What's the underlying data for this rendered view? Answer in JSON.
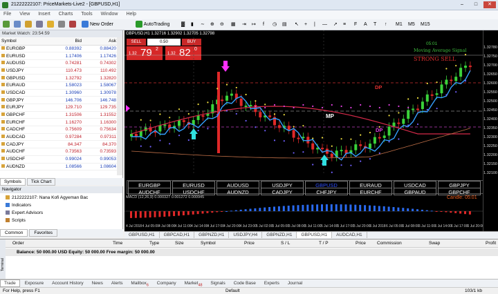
{
  "window": {
    "title": "21222222107: PriceMarkets-Live2 - [GBPUSD,H1]"
  },
  "menu": [
    "File",
    "View",
    "Insert",
    "Charts",
    "Tools",
    "Window",
    "Help"
  ],
  "toolbar": {
    "new_order": "New Order",
    "auto_trading": "AutoTrading"
  },
  "market_watch": {
    "header": "Market Watch: 23:54:59",
    "columns": [
      "Symbol",
      "Bid",
      "Ask"
    ],
    "rows": [
      {
        "symbol": "EURGBP",
        "bid": "0.88392",
        "ask": "0.88420",
        "dir": "up"
      },
      {
        "symbol": "EURUSD",
        "bid": "1.17406",
        "ask": "1.17426",
        "dir": "up"
      },
      {
        "symbol": "AUDUSD",
        "bid": "0.74281",
        "ask": "0.74302",
        "dir": "dn"
      },
      {
        "symbol": "USDJPY",
        "bid": "110.473",
        "ask": "110.492",
        "dir": "dn"
      },
      {
        "symbol": "GBPUSD",
        "bid": "1.32792",
        "ask": "1.32820",
        "dir": "dn"
      },
      {
        "symbol": "EURAUD",
        "bid": "1.58023",
        "ask": "1.58067",
        "dir": "up"
      },
      {
        "symbol": "USDCAD",
        "bid": "1.30960",
        "ask": "1.30978",
        "dir": "up"
      },
      {
        "symbol": "GBPJPY",
        "bid": "146.706",
        "ask": "146.748",
        "dir": "up"
      },
      {
        "symbol": "EURJPY",
        "bid": "129.710",
        "ask": "129.735",
        "dir": "dn"
      },
      {
        "symbol": "GBPCHF",
        "bid": "1.31506",
        "ask": "1.31552",
        "dir": "dn"
      },
      {
        "symbol": "EURCHF",
        "bid": "1.16270",
        "ask": "1.16300",
        "dir": "dn"
      },
      {
        "symbol": "CADCHF",
        "bid": "0.75609",
        "ask": "0.75634",
        "dir": "dn"
      },
      {
        "symbol": "AUDCAD",
        "bid": "0.97284",
        "ask": "0.97311",
        "dir": "dn"
      },
      {
        "symbol": "CADJPY",
        "bid": "84.347",
        "ask": "84.370",
        "dir": "dn"
      },
      {
        "symbol": "AUDCHF",
        "bid": "0.73563",
        "ask": "0.73593",
        "dir": "dn"
      },
      {
        "symbol": "USDCHF",
        "bid": "0.99024",
        "ask": "0.99053",
        "dir": "up"
      },
      {
        "symbol": "AUDNZD",
        "bid": "1.08566",
        "ask": "1.08604",
        "dir": "up"
      }
    ],
    "tabs": [
      "Symbols",
      "Tick Chart"
    ]
  },
  "navigator": {
    "header": "Navigator",
    "items": [
      "2122222107: Nana Kofi Agyeman Bac",
      "Indicators",
      "Expert Advisors",
      "Scripts"
    ],
    "tabs": [
      "Common",
      "Favorites"
    ]
  },
  "chart": {
    "title": "GBPUSD,H1  1.32716 1.32902 1.32705 1.32798",
    "sell_label": "SELL",
    "buy_label": "BUY",
    "lot": "0.50",
    "sell_small": "1.32",
    "sell_big": "79",
    "sell_sup": "2",
    "buy_small": "1.32",
    "buy_big": "82",
    "buy_sup": "0",
    "ma_signal": "Moving Average Signal",
    "strong_sell": "STRONG SELL",
    "dp_label": "DP",
    "mp_label": "MP",
    "candle_label": "Candle:  05:01",
    "clock": "05:01",
    "macd_label": "MACD (12,26,9) 0.000327 0.001272 0.000945",
    "pairs_row1": [
      "EURGBP",
      "EURUSD",
      "AUDUSD",
      "USDJPY",
      "GBPUSD",
      "EURAUD",
      "USDCAD",
      "GBPJPY"
    ],
    "pairs_row2": [
      "AUDCHF",
      "USDCHF",
      "AUDNZD",
      "CADJPY",
      "CHFJPY",
      "EURCHF",
      "GBPAUD",
      "GBPCHF"
    ],
    "price_labels": [
      "1.32780",
      "1.32750",
      "1.32700",
      "1.32650",
      "1.32600",
      "1.32550",
      "1.32500",
      "1.32450",
      "1.32400",
      "1.32350",
      "1.32300",
      "1.32250",
      "1.32200",
      "1.32150",
      "1.32100"
    ],
    "time_labels": [
      "4 Jul 2018",
      "4 Jul 05:00",
      "4 Jul 08:00",
      "4 Jul 11:00",
      "4 Jul 14:00",
      "4 Jul 17:00",
      "4 Jul 20:00",
      "4 Jul 23:00",
      "5 Jul 02:00",
      "5 Jul 05:00",
      "5 Jul 08:00",
      "5 Jul 11:00",
      "5 Jul 14:00",
      "5 Jul 17:00",
      "5 Jul 20:00",
      "6 Jul 2018",
      "6 Jul 05:00",
      "6 Jul 08:00",
      "6 Jul 11:00",
      "6 Jul 14:00",
      "6 Jul 17:00",
      "6 Jul 20:00"
    ]
  },
  "chart_tabs": [
    "GBPUSD,H1",
    "GBPCAD,H1",
    "GBPNZD,H1",
    "USDJPY,H4",
    "GBPNZD,H1",
    "GBPUSD,H1",
    "AUDCAD,H1"
  ],
  "terminal": {
    "columns": [
      "Order",
      "Time",
      "Type",
      "Size",
      "Symbol",
      "Price",
      "S / L",
      "T / P",
      "Price",
      "Commission",
      "Swap",
      "Profit"
    ],
    "balance": "Balance: 50 000.00 USD  Equity: 50 000.00  Free margin: 50 000.00",
    "side_label": "Terminal",
    "tabs": [
      "Trade",
      "Exposure",
      "Account History",
      "News",
      "Alerts",
      "Mailbox",
      "Company",
      "Market",
      "Signals",
      "Code Base",
      "Experts",
      "Journal"
    ],
    "mailbox_badge": "6",
    "market_badge": "48"
  },
  "status": {
    "left": "For Help, press F1",
    "middle": "Default",
    "right": "103/1 kb"
  }
}
